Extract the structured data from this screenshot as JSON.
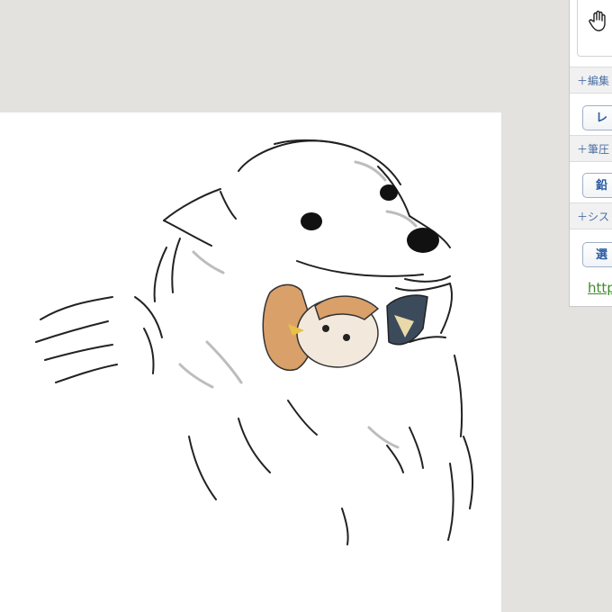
{
  "side_panel": {
    "tool_icon": "hand-icon",
    "sections": [
      {
        "header": "＋編集",
        "button": "レ"
      },
      {
        "header": "＋筆圧",
        "button": "鉛"
      },
      {
        "header": "＋シス",
        "button": "選"
      }
    ],
    "link_text": "http"
  },
  "canvas": {
    "background": "#ffffff",
    "artwork": "sketch"
  },
  "colors": {
    "workspace": "#e3e2de",
    "link": "#3f8a2a",
    "section_text": "#4a6fa5",
    "button_text": "#2a5aa0"
  }
}
